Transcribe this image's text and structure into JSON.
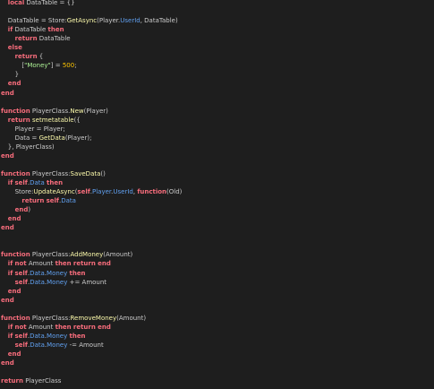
{
  "editor": {
    "colors": {
      "background": "#1e1e1e",
      "keyword": "#f86d7c",
      "text": "#cccccc",
      "function_call": "#fdfbac",
      "property": "#61a1f1",
      "string": "#adf195",
      "number": "#ffc600"
    },
    "lines": [
      {
        "indent": 1,
        "tokens": [
          [
            "kw",
            "local"
          ],
          [
            "txt",
            " DataTable = {}"
          ]
        ]
      },
      {
        "indent": 0,
        "tokens": []
      },
      {
        "indent": 1,
        "tokens": [
          [
            "txt",
            "DataTable = Store:"
          ],
          [
            "fn",
            "GetAsync"
          ],
          [
            "txt",
            "(Player."
          ],
          [
            "prop",
            "UserId"
          ],
          [
            "txt",
            ", DataTable)"
          ]
        ]
      },
      {
        "indent": 1,
        "tokens": [
          [
            "kw",
            "if"
          ],
          [
            "txt",
            " DataTable "
          ],
          [
            "kw",
            "then"
          ]
        ]
      },
      {
        "indent": 2,
        "tokens": [
          [
            "kw",
            "return"
          ],
          [
            "txt",
            " DataTable"
          ]
        ]
      },
      {
        "indent": 1,
        "tokens": [
          [
            "kw",
            "else"
          ]
        ]
      },
      {
        "indent": 2,
        "tokens": [
          [
            "kw",
            "return"
          ],
          [
            "txt",
            " {"
          ]
        ]
      },
      {
        "indent": 3,
        "tokens": [
          [
            "txt",
            "["
          ],
          [
            "str",
            "\"Money\""
          ],
          [
            "txt",
            "] = "
          ],
          [
            "num",
            "500"
          ],
          [
            "txt",
            ";"
          ]
        ]
      },
      {
        "indent": 2,
        "tokens": [
          [
            "txt",
            "}"
          ]
        ]
      },
      {
        "indent": 1,
        "tokens": [
          [
            "kw",
            "end"
          ]
        ]
      },
      {
        "indent": 0,
        "tokens": [
          [
            "kw",
            "end"
          ]
        ]
      },
      {
        "indent": 0,
        "tokens": []
      },
      {
        "indent": 0,
        "tokens": [
          [
            "kw",
            "function"
          ],
          [
            "txt",
            " PlayerClass."
          ],
          [
            "fn",
            "New"
          ],
          [
            "txt",
            "(Player)"
          ]
        ]
      },
      {
        "indent": 1,
        "tokens": [
          [
            "kw",
            "return"
          ],
          [
            "txt",
            " "
          ],
          [
            "fn",
            "setmetatable"
          ],
          [
            "txt",
            "({"
          ]
        ]
      },
      {
        "indent": 2,
        "tokens": [
          [
            "txt",
            "Player = Player;"
          ]
        ]
      },
      {
        "indent": 2,
        "tokens": [
          [
            "txt",
            "Data = "
          ],
          [
            "fn",
            "GetData"
          ],
          [
            "txt",
            "(Player);"
          ]
        ]
      },
      {
        "indent": 1,
        "tokens": [
          [
            "txt",
            "}, PlayerClass)"
          ]
        ]
      },
      {
        "indent": 0,
        "tokens": [
          [
            "kw",
            "end"
          ]
        ]
      },
      {
        "indent": 0,
        "tokens": []
      },
      {
        "indent": 0,
        "tokens": [
          [
            "kw",
            "function"
          ],
          [
            "txt",
            " PlayerClass:"
          ],
          [
            "fn",
            "SaveData"
          ],
          [
            "txt",
            "()"
          ]
        ]
      },
      {
        "indent": 1,
        "tokens": [
          [
            "kw",
            "if"
          ],
          [
            "txt",
            " "
          ],
          [
            "kw",
            "self"
          ],
          [
            "txt",
            "."
          ],
          [
            "prop",
            "Data"
          ],
          [
            "txt",
            " "
          ],
          [
            "kw",
            "then"
          ]
        ]
      },
      {
        "indent": 2,
        "tokens": [
          [
            "txt",
            "Store:"
          ],
          [
            "fn",
            "UpdateAsync"
          ],
          [
            "txt",
            "("
          ],
          [
            "kw",
            "self"
          ],
          [
            "txt",
            "."
          ],
          [
            "prop",
            "Player"
          ],
          [
            "txt",
            "."
          ],
          [
            "prop",
            "UserId"
          ],
          [
            "txt",
            ", "
          ],
          [
            "kw",
            "function"
          ],
          [
            "txt",
            "(Old)"
          ]
        ]
      },
      {
        "indent": 3,
        "tokens": [
          [
            "kw",
            "return"
          ],
          [
            "txt",
            " "
          ],
          [
            "kw",
            "self"
          ],
          [
            "txt",
            "."
          ],
          [
            "prop",
            "Data"
          ]
        ]
      },
      {
        "indent": 2,
        "tokens": [
          [
            "kw",
            "end"
          ],
          [
            "txt",
            ")"
          ]
        ]
      },
      {
        "indent": 1,
        "tokens": [
          [
            "kw",
            "end"
          ]
        ]
      },
      {
        "indent": 0,
        "tokens": [
          [
            "kw",
            "end"
          ]
        ]
      },
      {
        "indent": 0,
        "tokens": []
      },
      {
        "indent": 0,
        "tokens": []
      },
      {
        "indent": 0,
        "tokens": [
          [
            "kw",
            "function"
          ],
          [
            "txt",
            " PlayerClass:"
          ],
          [
            "fn",
            "AddMoney"
          ],
          [
            "txt",
            "(Amount)"
          ]
        ]
      },
      {
        "indent": 1,
        "tokens": [
          [
            "kw",
            "if"
          ],
          [
            "txt",
            " "
          ],
          [
            "kw",
            "not"
          ],
          [
            "txt",
            " Amount "
          ],
          [
            "kw",
            "then"
          ],
          [
            "txt",
            " "
          ],
          [
            "kw",
            "return"
          ],
          [
            "txt",
            " "
          ],
          [
            "kw",
            "end"
          ]
        ]
      },
      {
        "indent": 1,
        "tokens": [
          [
            "kw",
            "if"
          ],
          [
            "txt",
            " "
          ],
          [
            "kw",
            "self"
          ],
          [
            "txt",
            "."
          ],
          [
            "prop",
            "Data"
          ],
          [
            "txt",
            "."
          ],
          [
            "prop",
            "Money"
          ],
          [
            "txt",
            " "
          ],
          [
            "kw",
            "then"
          ]
        ]
      },
      {
        "indent": 2,
        "tokens": [
          [
            "kw",
            "self"
          ],
          [
            "txt",
            "."
          ],
          [
            "prop",
            "Data"
          ],
          [
            "txt",
            "."
          ],
          [
            "prop",
            "Money"
          ],
          [
            "txt",
            " += Amount"
          ]
        ]
      },
      {
        "indent": 1,
        "tokens": [
          [
            "kw",
            "end"
          ]
        ]
      },
      {
        "indent": 0,
        "tokens": [
          [
            "kw",
            "end"
          ]
        ]
      },
      {
        "indent": 0,
        "tokens": []
      },
      {
        "indent": 0,
        "tokens": [
          [
            "kw",
            "function"
          ],
          [
            "txt",
            " PlayerClass:"
          ],
          [
            "fn",
            "RemoveMoney"
          ],
          [
            "txt",
            "(Amount)"
          ]
        ]
      },
      {
        "indent": 1,
        "tokens": [
          [
            "kw",
            "if"
          ],
          [
            "txt",
            " "
          ],
          [
            "kw",
            "not"
          ],
          [
            "txt",
            " Amount "
          ],
          [
            "kw",
            "then"
          ],
          [
            "txt",
            " "
          ],
          [
            "kw",
            "return"
          ],
          [
            "txt",
            " "
          ],
          [
            "kw",
            "end"
          ]
        ]
      },
      {
        "indent": 1,
        "tokens": [
          [
            "kw",
            "if"
          ],
          [
            "txt",
            " "
          ],
          [
            "kw",
            "self"
          ],
          [
            "txt",
            "."
          ],
          [
            "prop",
            "Data"
          ],
          [
            "txt",
            "."
          ],
          [
            "prop",
            "Money"
          ],
          [
            "txt",
            " "
          ],
          [
            "kw",
            "then"
          ]
        ]
      },
      {
        "indent": 2,
        "tokens": [
          [
            "kw",
            "self"
          ],
          [
            "txt",
            "."
          ],
          [
            "prop",
            "Data"
          ],
          [
            "txt",
            "."
          ],
          [
            "prop",
            "Money"
          ],
          [
            "txt",
            " -= Amount"
          ]
        ]
      },
      {
        "indent": 1,
        "tokens": [
          [
            "kw",
            "end"
          ]
        ]
      },
      {
        "indent": 0,
        "tokens": [
          [
            "kw",
            "end"
          ]
        ]
      },
      {
        "indent": 0,
        "tokens": []
      },
      {
        "indent": 0,
        "tokens": [
          [
            "kw",
            "return"
          ],
          [
            "txt",
            " PlayerClass"
          ]
        ]
      }
    ]
  }
}
